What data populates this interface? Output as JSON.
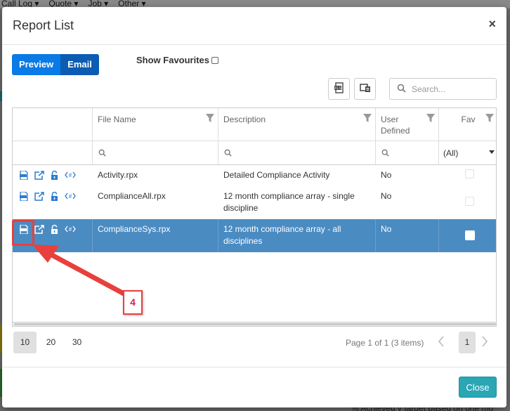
{
  "background": {
    "menu": [
      "Call Log ▾",
      "Quote ▾",
      "Job ▾",
      "Other ▾"
    ],
    "bottom_text": "% Achieved v target based on one mo"
  },
  "modal": {
    "title": "Report List",
    "close_icon": "×"
  },
  "toolbar": {
    "preview_label": "Preview",
    "email_label": "Email",
    "show_favourites_label": "Show Favourites",
    "show_favourites_checked": false,
    "export_excel_icon": "excel-export-icon",
    "column_chooser_icon": "column-chooser-icon",
    "search_placeholder": "Search..."
  },
  "grid": {
    "columns": [
      {
        "key": "file_name",
        "label": "File Name"
      },
      {
        "key": "description",
        "label": "Description"
      },
      {
        "key": "user_defined",
        "label": "User Defined"
      },
      {
        "key": "fav",
        "label": "Fav"
      }
    ],
    "fav_filter_value": "(All)",
    "rows": [
      {
        "file_name": "Activity.rpx",
        "description": "Detailed Compliance Activity",
        "user_defined": "No",
        "fav": false,
        "selected": false
      },
      {
        "file_name": "ComplianceAll.rpx",
        "description": "12 month compliance array - single discipline",
        "user_defined": "No",
        "fav": false,
        "selected": false
      },
      {
        "file_name": "ComplianceSys.rpx",
        "description": "12 month compliance array - all disciplines",
        "user_defined": "No",
        "fav": false,
        "selected": true
      }
    ],
    "row_action_icons": [
      "pdf-report-icon",
      "open-external-icon",
      "unlock-icon",
      "code-tag-icon"
    ]
  },
  "pager": {
    "sizes": [
      "10",
      "20",
      "30"
    ],
    "active_size": "10",
    "info": "Page 1 of 1 (3 items)",
    "current_page": "1",
    "prev_icon": "‹",
    "next_icon": "›"
  },
  "footer": {
    "close_label": "Close"
  },
  "annotation": {
    "step_label": "4",
    "color": "#e8403c"
  }
}
